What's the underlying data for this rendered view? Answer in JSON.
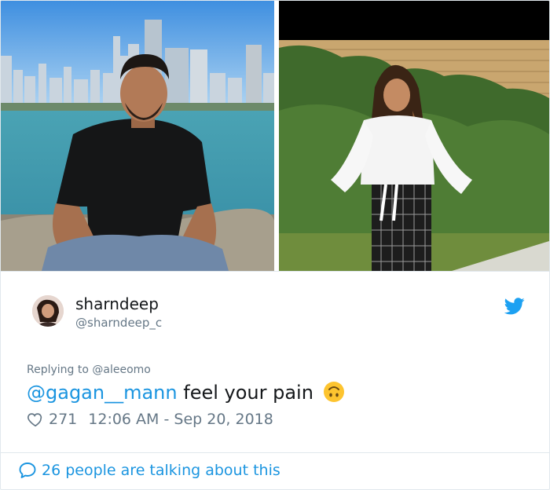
{
  "tweet": {
    "display_name": "sharndeep",
    "handle": "@sharndeep_c",
    "replying_to_prefix": "Replying to ",
    "replying_to_handle": "@aleeomo",
    "mention": "@gagan__mann",
    "text": " feel your pain",
    "emoji": "upside-down-face",
    "likes": "271",
    "timestamp": "12:06 AM - Sep 20, 2018"
  },
  "footer": {
    "talking_label": "26 people are talking about this"
  },
  "colors": {
    "link_blue": "#1b95e0",
    "text_primary": "#14171a",
    "text_secondary": "#657786",
    "border": "#e1e8ed"
  },
  "icons": {
    "brand": "twitter-bird-icon",
    "like": "heart-outline-icon",
    "conversation": "speech-bubble-icon"
  }
}
